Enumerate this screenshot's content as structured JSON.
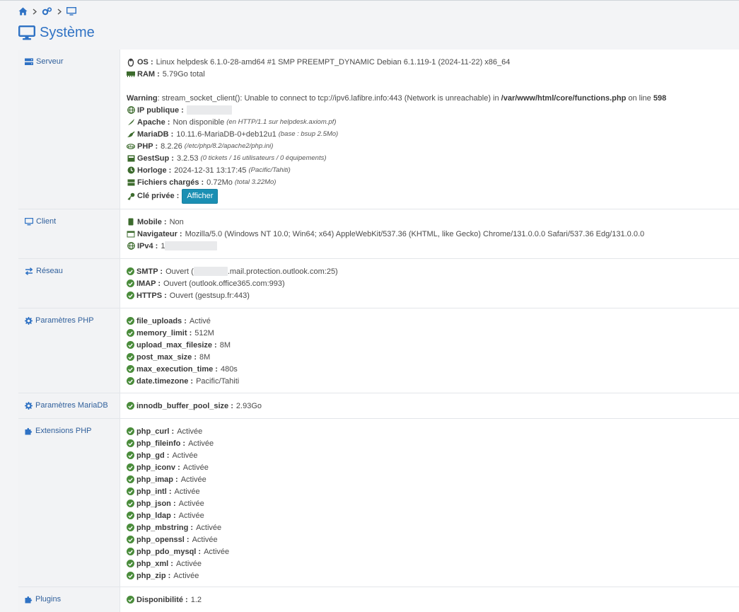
{
  "page": {
    "title": "Système"
  },
  "colors": {
    "accent": "#2f72c4",
    "ok": "#4a8c3b",
    "button": "#1b8fb3"
  },
  "server": {
    "section_label": "Serveur",
    "os_label": "OS :",
    "os_value": "Linux helpdesk 6.1.0-28-amd64 #1 SMP PREEMPT_DYNAMIC Debian 6.1.119-1 (2024-11-22) x86_64",
    "ram_label": "RAM :",
    "ram_value": "5.79Go total",
    "warning_label": "Warning",
    "warning_text": ": stream_socket_client(): Unable to connect to tcp://ipv6.lafibre.info:443 (Network is unreachable) in ",
    "warning_file": "/var/www/html/core/functions.php",
    "warning_online": " on line ",
    "warning_line": "598",
    "ip_label": "IP publique :",
    "apache_label": "Apache :",
    "apache_value": "Non disponible",
    "apache_note": "(en HTTP/1.1 sur helpdesk.axiom.pf)",
    "mariadb_label": "MariaDB :",
    "mariadb_value": "10.11.6-MariaDB-0+deb12u1",
    "mariadb_note": "(base : bsup 2.5Mo)",
    "php_label": "PHP :",
    "php_value": "8.2.26",
    "php_note": "(/etc/php/8.2/apache2/php.ini)",
    "gestsup_label": "GestSup :",
    "gestsup_value": "3.2.53",
    "gestsup_note": "(0 tickets / 16 utilisateurs / 0 équipements)",
    "clock_label": "Horloge :",
    "clock_value": "2024-12-31 13:17:45",
    "clock_note": "(Pacific/Tahiti)",
    "files_label": "Fichiers chargés :",
    "files_value": "0.72Mo",
    "files_note": "(total 3.22Mo)",
    "key_label": "Clé privée :",
    "key_button": "Afficher"
  },
  "client": {
    "section_label": "Client",
    "mobile_label": "Mobile :",
    "mobile_value": "Non",
    "browser_label": "Navigateur :",
    "browser_value": "Mozilla/5.0 (Windows NT 10.0; Win64; x64) AppleWebKit/537.36 (KHTML, like Gecko) Chrome/131.0.0.0 Safari/537.36 Edg/131.0.0.0",
    "ipv4_label": "IPv4 :",
    "ipv4_value": "1"
  },
  "network": {
    "section_label": "Réseau",
    "smtp_label": "SMTP :",
    "smtp_prefix": "Ouvert (",
    "smtp_suffix": ".mail.protection.outlook.com:25)",
    "imap_label": "IMAP :",
    "imap_value": "Ouvert (outlook.office365.com:993)",
    "https_label": "HTTPS :",
    "https_value": "Ouvert (gestsup.fr:443)"
  },
  "php_params": {
    "section_label": "Paramètres PHP",
    "items": [
      {
        "label": "file_uploads",
        "value": "Activé"
      },
      {
        "label": "memory_limit",
        "value": "512M"
      },
      {
        "label": "upload_max_filesize",
        "value": "8M"
      },
      {
        "label": "post_max_size",
        "value": "8M"
      },
      {
        "label": "max_execution_time",
        "value": "480s"
      },
      {
        "label": "date.timezone",
        "value": "Pacific/Tahiti"
      }
    ]
  },
  "mariadb_params": {
    "section_label": "Paramètres MariaDB",
    "items": [
      {
        "label": "innodb_buffer_pool_size",
        "value": "2.93Go"
      }
    ]
  },
  "php_ext": {
    "section_label": "Extensions PHP",
    "items": [
      {
        "label": "php_curl",
        "value": "Activée"
      },
      {
        "label": "php_fileinfo",
        "value": "Activée"
      },
      {
        "label": "php_gd",
        "value": "Activée"
      },
      {
        "label": "php_iconv",
        "value": "Activée"
      },
      {
        "label": "php_imap",
        "value": "Activée"
      },
      {
        "label": "php_intl",
        "value": "Activée"
      },
      {
        "label": "php_json",
        "value": "Activée"
      },
      {
        "label": "php_ldap",
        "value": "Activée"
      },
      {
        "label": "php_mbstring",
        "value": "Activée"
      },
      {
        "label": "php_openssl",
        "value": "Activée"
      },
      {
        "label": "php_pdo_mysql",
        "value": "Activée"
      },
      {
        "label": "php_xml",
        "value": "Activée"
      },
      {
        "label": "php_zip",
        "value": "Activée"
      }
    ]
  },
  "plugins": {
    "section_label": "Plugins",
    "items": [
      {
        "label": "Disponibilité",
        "value": "1.2"
      }
    ]
  }
}
